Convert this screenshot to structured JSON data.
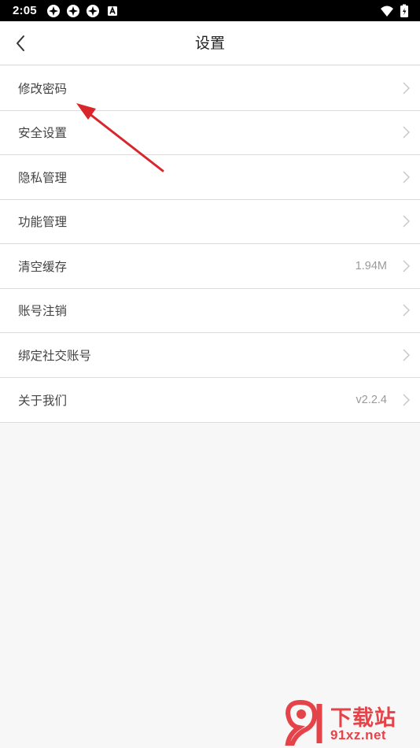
{
  "status_bar": {
    "time": "2:05",
    "icons": [
      "app-icon",
      "app-icon",
      "app-icon",
      "accessibility-icon",
      "wifi-icon",
      "battery-charging-icon"
    ]
  },
  "header": {
    "title": "设置",
    "back_icon": "chevron-left-icon"
  },
  "settings": {
    "items": [
      {
        "label": "修改密码",
        "value": ""
      },
      {
        "label": "安全设置",
        "value": ""
      },
      {
        "label": "隐私管理",
        "value": ""
      },
      {
        "label": "功能管理",
        "value": ""
      },
      {
        "label": "清空缓存",
        "value": "1.94M"
      },
      {
        "label": "账号注销",
        "value": ""
      },
      {
        "label": "绑定社交账号",
        "value": ""
      },
      {
        "label": "关于我们",
        "value": "v2.2.4"
      }
    ]
  },
  "annotation": {
    "color": "#d9262c"
  },
  "watermark": {
    "title": "下载站",
    "url": "91xz.net",
    "color": "#e4434a"
  }
}
